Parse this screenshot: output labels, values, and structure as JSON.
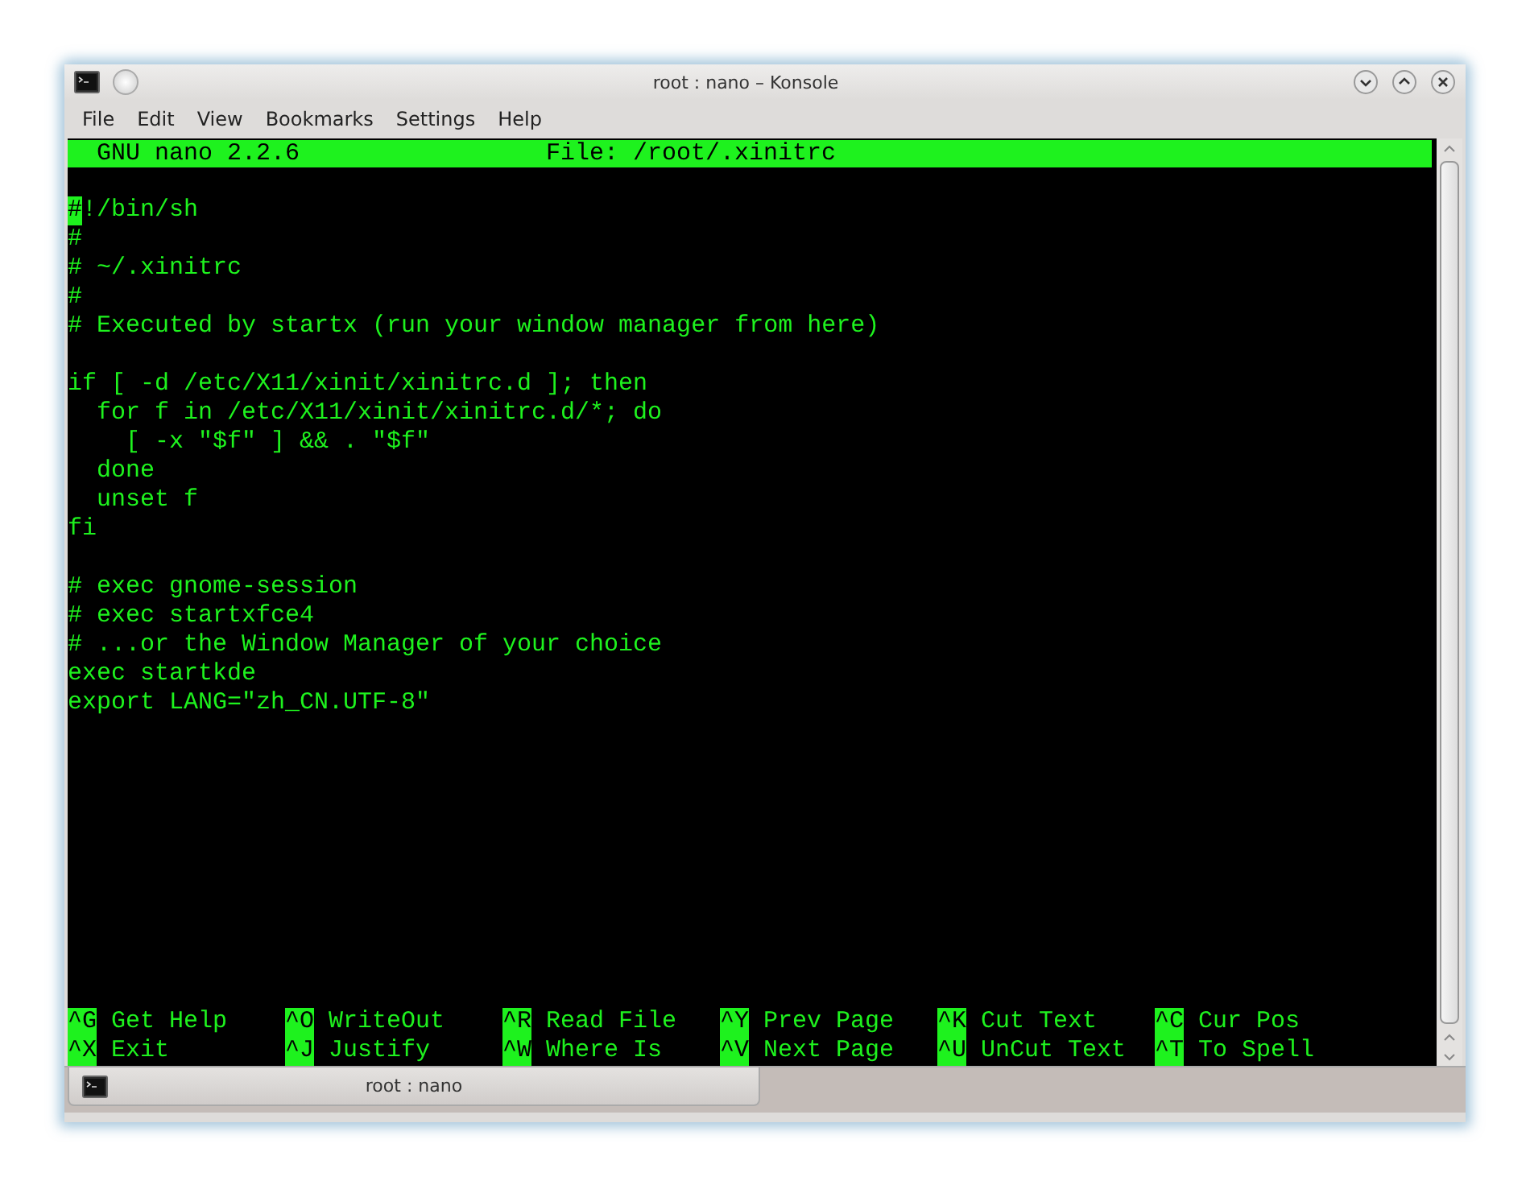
{
  "window": {
    "title": "root : nano – Konsole"
  },
  "menu": [
    "File",
    "Edit",
    "View",
    "Bookmarks",
    "Settings",
    "Help"
  ],
  "nano": {
    "version": "GNU nano 2.2.6",
    "file": "File: /root/.xinitrc"
  },
  "blocks": [
    {
      "lines": [
        {
          "text": "#!/bin/sh",
          "cursor": true
        },
        {
          "text": "#",
          "cursor": false
        },
        {
          "text": "# ~/.xinitrc",
          "cursor": false
        },
        {
          "text": "#",
          "cursor": false
        },
        {
          "text": "# Executed by startx (run your window manager from here)",
          "cursor": false
        }
      ]
    },
    {
      "lines": [
        {
          "text": "if [ -d /etc/X11/xinit/xinitrc.d ]; then",
          "cursor": false
        },
        {
          "text": "  for f in /etc/X11/xinit/xinitrc.d/*; do",
          "cursor": false
        },
        {
          "text": "    [ -x \"$f\" ] && . \"$f\"",
          "cursor": false
        },
        {
          "text": "  done",
          "cursor": false
        },
        {
          "text": "  unset f",
          "cursor": false
        },
        {
          "text": "fi",
          "cursor": false
        }
      ]
    },
    {
      "lines": [
        {
          "text": "# exec gnome-session",
          "cursor": false
        },
        {
          "text": "# exec startxfce4",
          "cursor": false
        },
        {
          "text": "# ...or the Window Manager of your choice",
          "cursor": false
        },
        {
          "text": "exec startkde",
          "cursor": false
        },
        {
          "text": "export LANG=\"zh_CN.UTF-8\"",
          "cursor": false
        }
      ]
    }
  ],
  "shortcuts": [
    [
      {
        "key": "^G",
        "label": "Get Help"
      },
      {
        "key": "^O",
        "label": "WriteOut"
      },
      {
        "key": "^R",
        "label": "Read File"
      },
      {
        "key": "^Y",
        "label": "Prev Page"
      },
      {
        "key": "^K",
        "label": "Cut Text"
      },
      {
        "key": "^C",
        "label": "Cur Pos"
      }
    ],
    [
      {
        "key": "^X",
        "label": "Exit"
      },
      {
        "key": "^J",
        "label": "Justify"
      },
      {
        "key": "^W",
        "label": "Where Is"
      },
      {
        "key": "^V",
        "label": "Next Page"
      },
      {
        "key": "^U",
        "label": "UnCut Text"
      },
      {
        "key": "^T",
        "label": "To Spell"
      }
    ]
  ],
  "tabs": [
    {
      "label": "root : nano",
      "selected": true
    }
  ]
}
